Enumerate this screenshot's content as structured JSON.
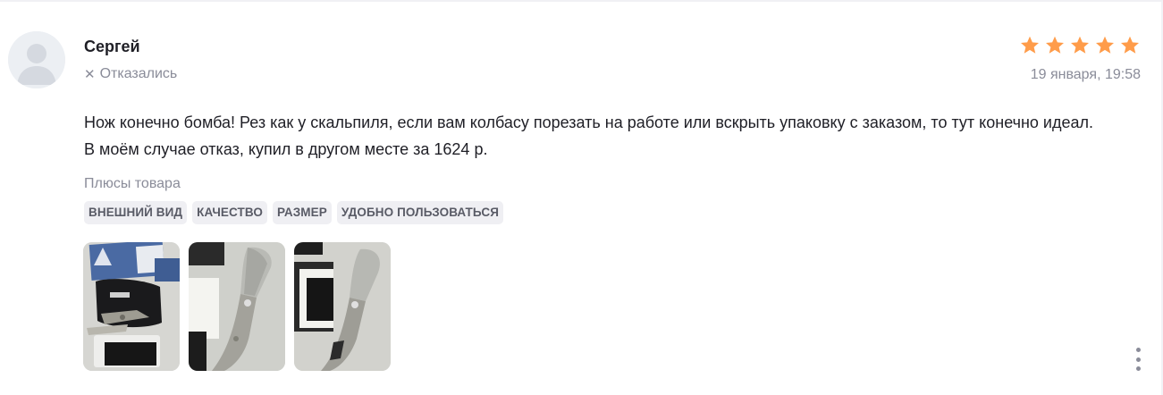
{
  "review": {
    "author": "Сергей",
    "status_icon": "close-icon",
    "status": "Отказались",
    "rating": 5,
    "rating_max": 5,
    "star_color": "#ff9c4a",
    "date": "19 января, 19:58",
    "text": "Нож конечно бомба! Рез как у скальпиля, если вам колбасу порезать на работе или вскрыть упаковку с заказом, то тут конечно идеал. В моём случае отказ, купил в другом месте за 1624 р.",
    "pros_label": "Плюсы товара",
    "tags": [
      "ВНЕШНИЙ ВИД",
      "КАЧЕСТВО",
      "РАЗМЕР",
      "УДОБНО ПОЛЬЗОВАТЬСЯ"
    ],
    "photo_count": 3,
    "more_icon": "more-vertical-icon"
  }
}
